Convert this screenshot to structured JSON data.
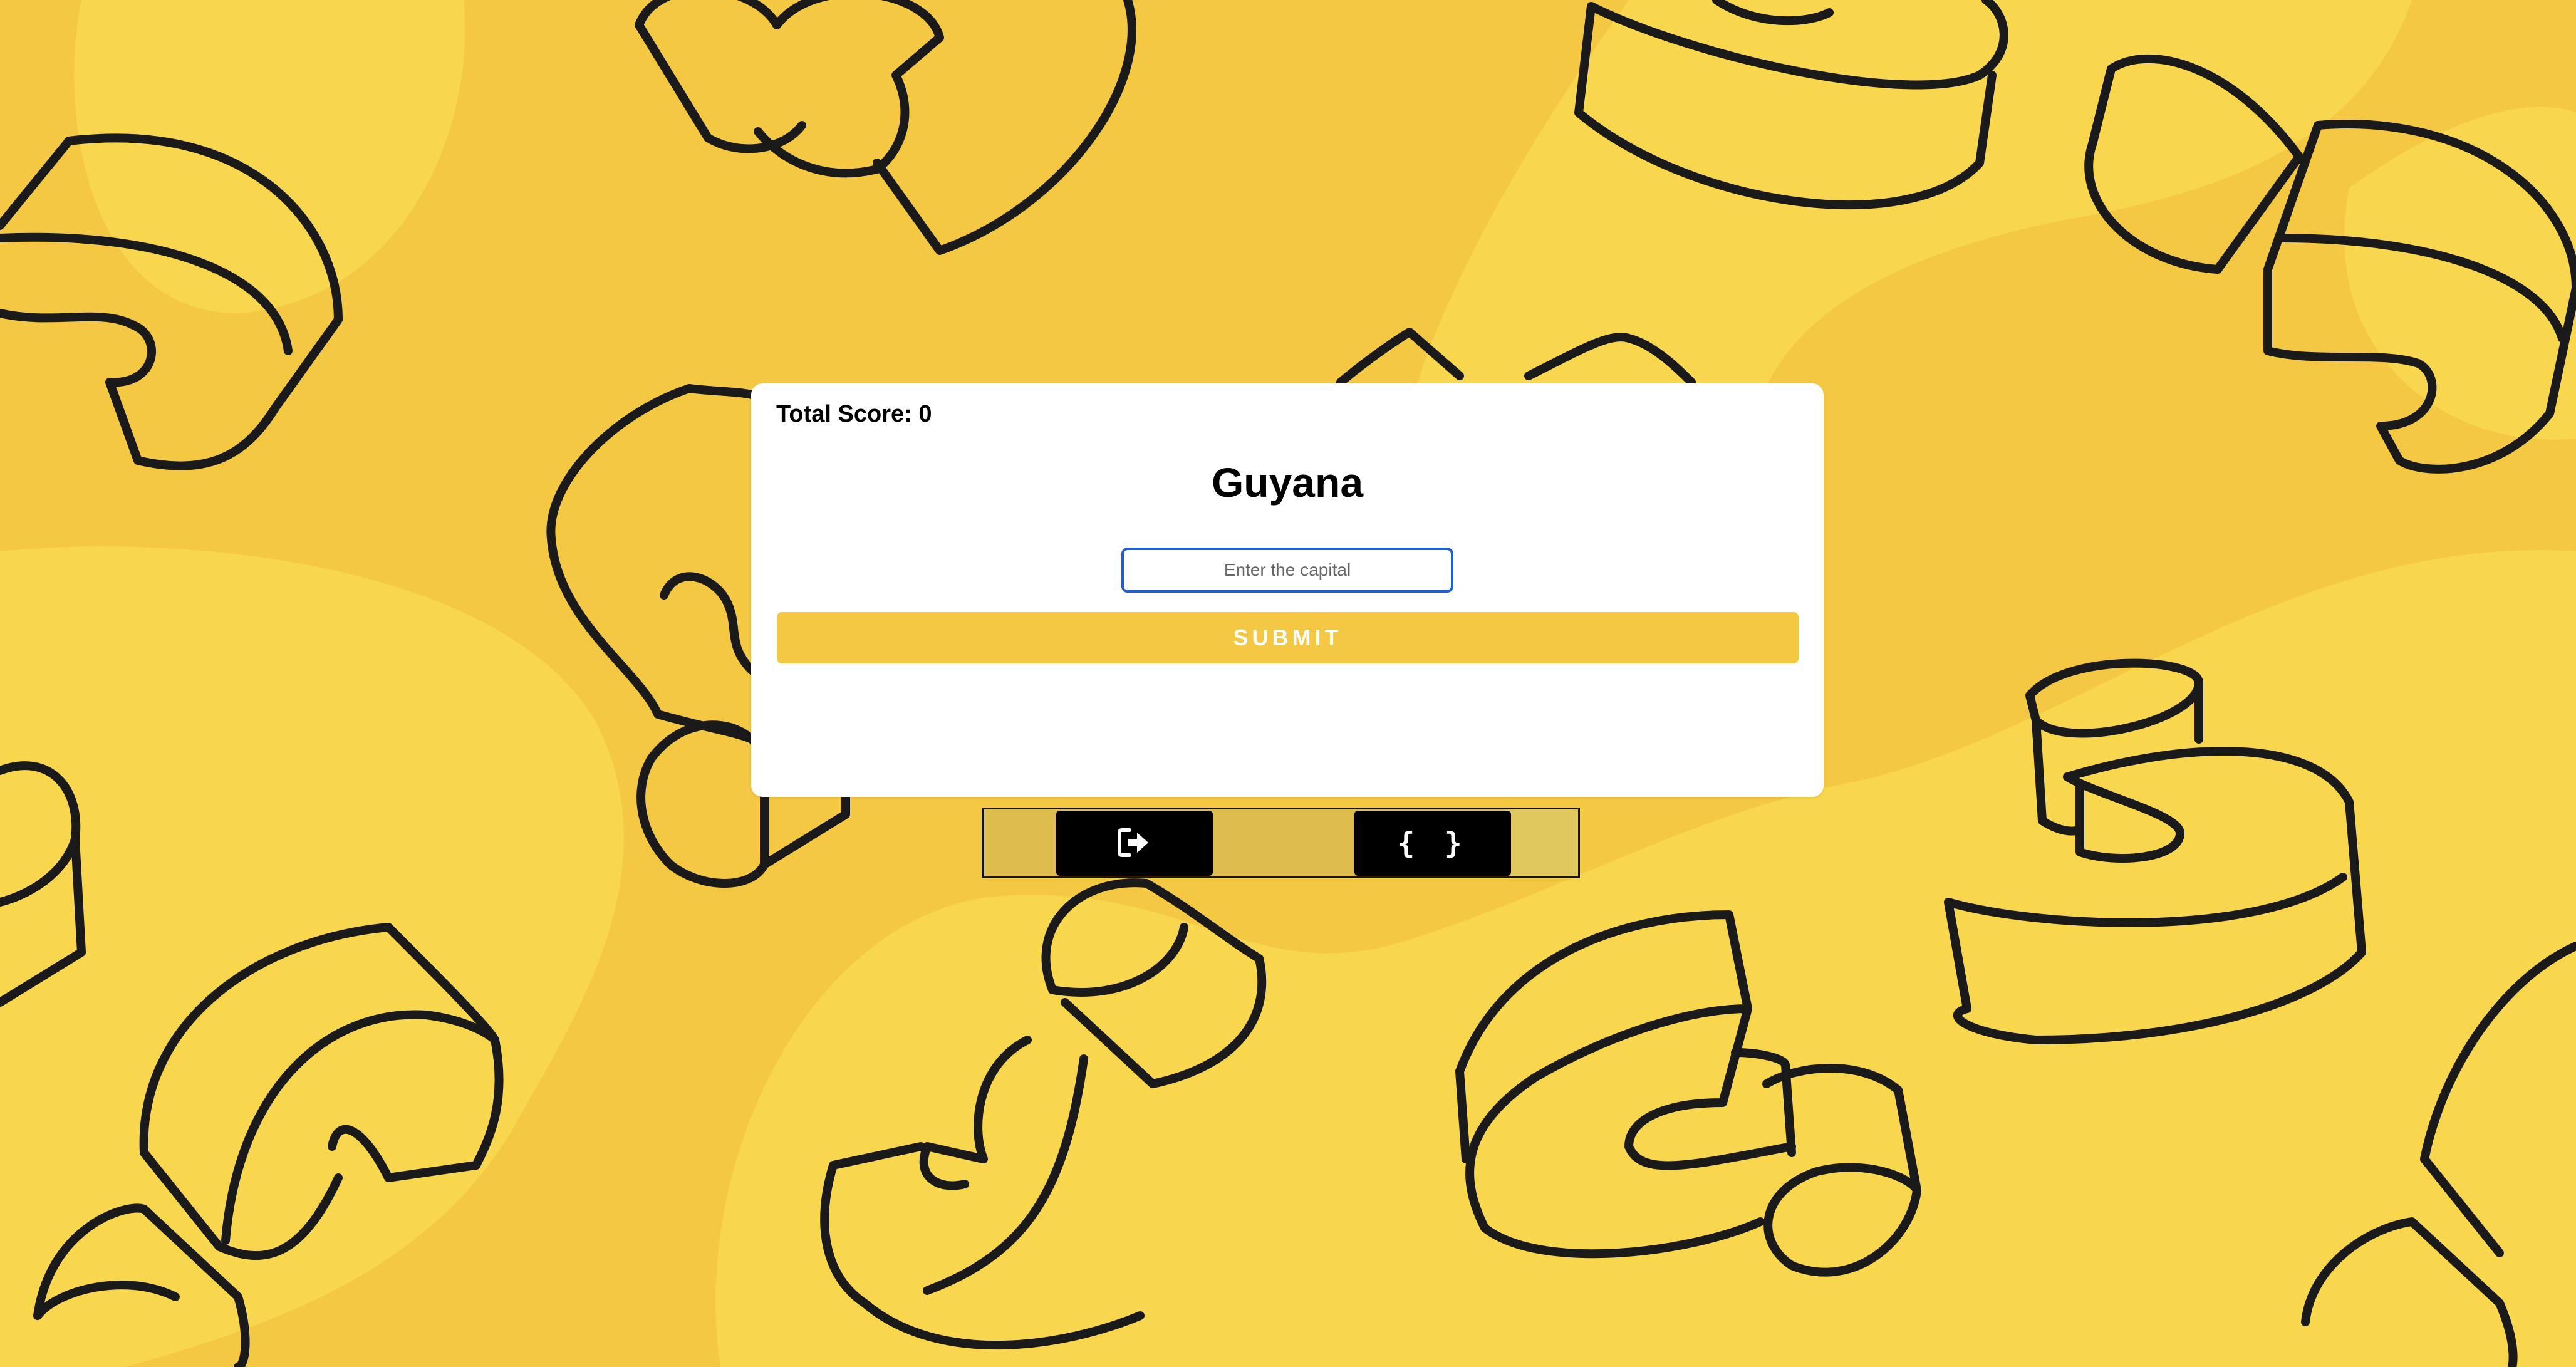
{
  "score": {
    "label": "Total Score: 0"
  },
  "question": {
    "country": "Guyana"
  },
  "answer": {
    "placeholder": "Enter the capital",
    "value": ""
  },
  "submit": {
    "label": "SUBMIT"
  },
  "toolbar": {
    "exit_icon": "sign-out-icon",
    "code_icon": "code-braces-icon",
    "code_glyph": "{ }"
  },
  "colors": {
    "background": "#f5c843",
    "background_light": "#f8d74e",
    "card": "#ffffff",
    "accent": "#f5c843",
    "input_border": "#1e5ed6",
    "toolbar_button": "#000000"
  }
}
